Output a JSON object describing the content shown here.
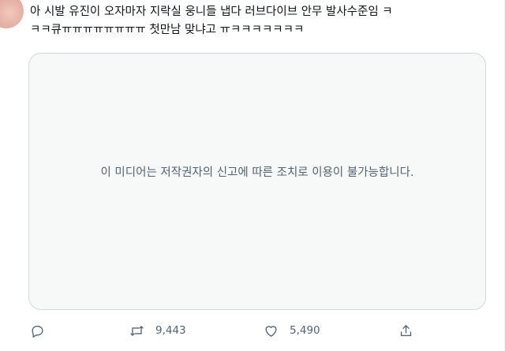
{
  "tweet": {
    "text_line1": "아 시발 유진이 오자마자 지락실 웅니들 냅다 러브다이브 안무 발사수준임 ㅋ",
    "text_line2": "ㅋㅋ큐ㅠㅠㅠㅠㅠㅠㅠㅠ 첫만남 맞냐고 ㅠㅋㅋㅋㅋㅋㅋㅋ"
  },
  "media": {
    "notice": "이 미디어는 저작권자의 신고에 따른 조치로 이용이 불가능합니다."
  },
  "actions": {
    "reply_icon": "reply-icon",
    "retweet_icon": "retweet-icon",
    "retweet_count": "9,443",
    "like_icon": "heart-icon",
    "like_count": "5,490",
    "share_icon": "share-icon"
  },
  "colors": {
    "text": "#0f1419",
    "secondary": "#536471",
    "border": "#cfd9de",
    "media_bg": "#f7f9f9"
  }
}
